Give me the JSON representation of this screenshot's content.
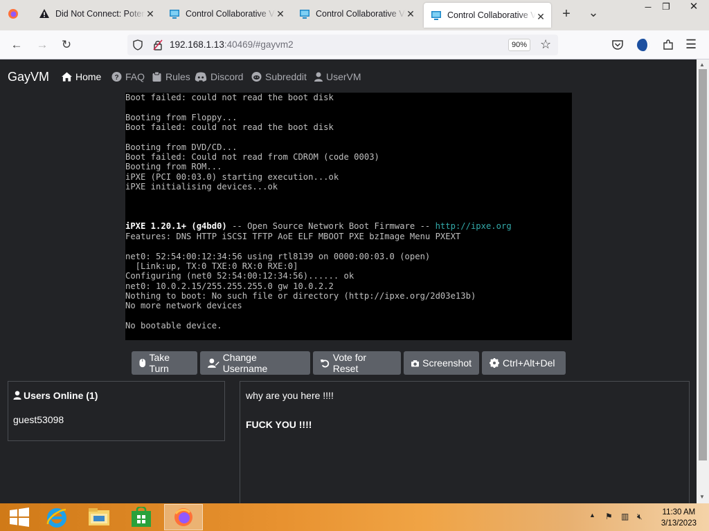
{
  "tabs": [
    {
      "title": "Did Not Connect: Potential Security Issue",
      "icon": "warning-icon",
      "active": false
    },
    {
      "title": "Control Collaborative Virtual Machines",
      "icon": "monitor-icon",
      "active": false
    },
    {
      "title": "Control Collaborative Virtual Machines",
      "icon": "monitor-icon",
      "active": false
    },
    {
      "title": "Control Collaborative Virtual Machines",
      "icon": "monitor-icon",
      "active": true
    }
  ],
  "window": {
    "minimize": "—",
    "restore": "❐",
    "close": "✕",
    "new_tab": "+",
    "list_all": "⌄"
  },
  "address": {
    "host": "192.168.1.13",
    "rest": ":40469/#gayvm2",
    "zoom": "90%"
  },
  "site": {
    "brand": "GayVM",
    "nav": [
      {
        "label": "Home",
        "icon": "home-icon",
        "active": true
      },
      {
        "label": "FAQ",
        "icon": "question-icon",
        "active": false
      },
      {
        "label": "Rules",
        "icon": "clipboard-icon",
        "active": false
      },
      {
        "label": "Discord",
        "icon": "discord-icon",
        "active": false
      },
      {
        "label": "Subreddit",
        "icon": "reddit-icon",
        "active": false
      },
      {
        "label": "UserVM",
        "icon": "user-icon",
        "active": false
      }
    ]
  },
  "console_lines": [
    "Boot failed: could not read the boot disk",
    "",
    "Booting from Floppy...",
    "Boot failed: could not read the boot disk",
    "",
    "Booting from DVD/CD...",
    "Boot failed: Could not read from CDROM (code 0003)",
    "Booting from ROM...",
    "iPXE (PCI 00:03.0) starting execution...ok",
    "iPXE initialising devices...ok",
    "",
    "",
    "",
    "iPXE 1.20.1+ (g4bd0) -- Open Source Network Boot Firmware -- http://ipxe.org",
    "Features: DNS HTTP iSCSI TFTP AoE ELF MBOOT PXE bzImage Menu PXEXT",
    "",
    "net0: 52:54:00:12:34:56 using rtl8139 on 0000:00:03.0 (open)",
    "  [Link:up, TX:0 TXE:0 RX:0 RXE:0]",
    "Configuring (net0 52:54:00:12:34:56)...... ok",
    "net0: 10.0.2.15/255.255.255.0 gw 10.0.2.2",
    "Nothing to boot: No such file or directory (http://ipxe.org/2d03e13b)",
    "No more network devices",
    "",
    "No bootable device."
  ],
  "vm_buttons": [
    {
      "label": "Take Turn",
      "icon": "mouse-icon"
    },
    {
      "label": "Change Username",
      "icon": "user-edit-icon"
    },
    {
      "label": "Vote for Reset",
      "icon": "undo-icon"
    },
    {
      "label": "Screenshot",
      "icon": "camera-icon"
    },
    {
      "label": "Ctrl+Alt+Del",
      "icon": "gear-icon"
    }
  ],
  "users": {
    "heading": "Users Online (1)",
    "list": [
      "guest53098"
    ]
  },
  "chat": {
    "messages": [
      {
        "text": "why are you here !!!!",
        "bold": false
      },
      {
        "text": "FUCK YOU !!!!",
        "bold": true
      }
    ]
  },
  "taskbar": {
    "time": "11:30 AM",
    "date": "3/13/2023",
    "apps": [
      "start-button",
      "internet-explorer-icon",
      "file-explorer-icon",
      "store-icon",
      "firefox-icon"
    ]
  },
  "colors": {
    "page_bg": "#222326",
    "button_bg": "#5d6168",
    "console_cyan": "#33aaaa",
    "taskbar_orange": "#e89230"
  }
}
